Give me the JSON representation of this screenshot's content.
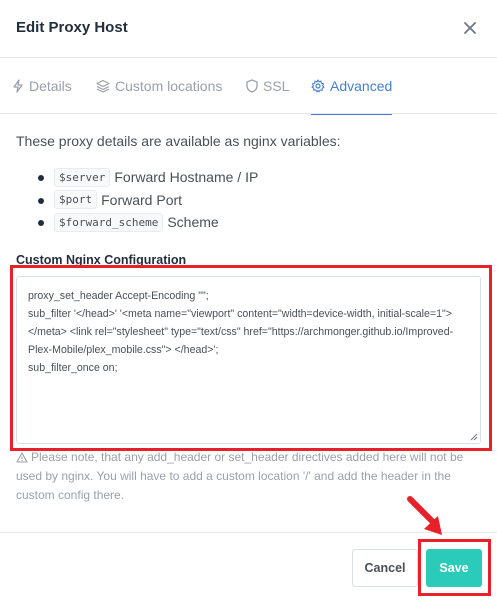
{
  "modal": {
    "title": "Edit Proxy Host",
    "close_icon": "close-icon"
  },
  "tabs": [
    {
      "label": "Details",
      "icon": "bolt-icon",
      "active": false
    },
    {
      "label": "Custom locations",
      "icon": "layers-icon",
      "active": false
    },
    {
      "label": "SSL",
      "icon": "shield-icon",
      "active": false
    },
    {
      "label": "Advanced",
      "icon": "gear-icon",
      "active": true
    }
  ],
  "content": {
    "intro": "These proxy details are available as nginx variables:",
    "variables": [
      {
        "code": "$server",
        "desc": "Forward Hostname / IP"
      },
      {
        "code": "$port",
        "desc": "Forward Port"
      },
      {
        "code": "$forward_scheme",
        "desc": "Scheme"
      }
    ],
    "config_label": "Custom Nginx Configuration",
    "config_value": "proxy_set_header Accept-Encoding \"\";\nsub_filter '</head>' '<meta name=\"viewport\" content=\"width=device-width, initial-scale=1\"></meta> <link rel=\"stylesheet\" type=\"text/css\" href=\"https://archmonger.github.io/Improved-Plex-Mobile/plex_mobile.css\"> </head>';\nsub_filter_once on;",
    "note": "Please note, that any add_header or set_header directives added here will not be used by nginx. You will have to add a custom location '/' and add the header in the custom config there."
  },
  "footer": {
    "cancel_label": "Cancel",
    "save_label": "Save"
  },
  "colors": {
    "accent": "#467fcf",
    "save": "#2bcbba",
    "highlight": "#e8202a"
  }
}
